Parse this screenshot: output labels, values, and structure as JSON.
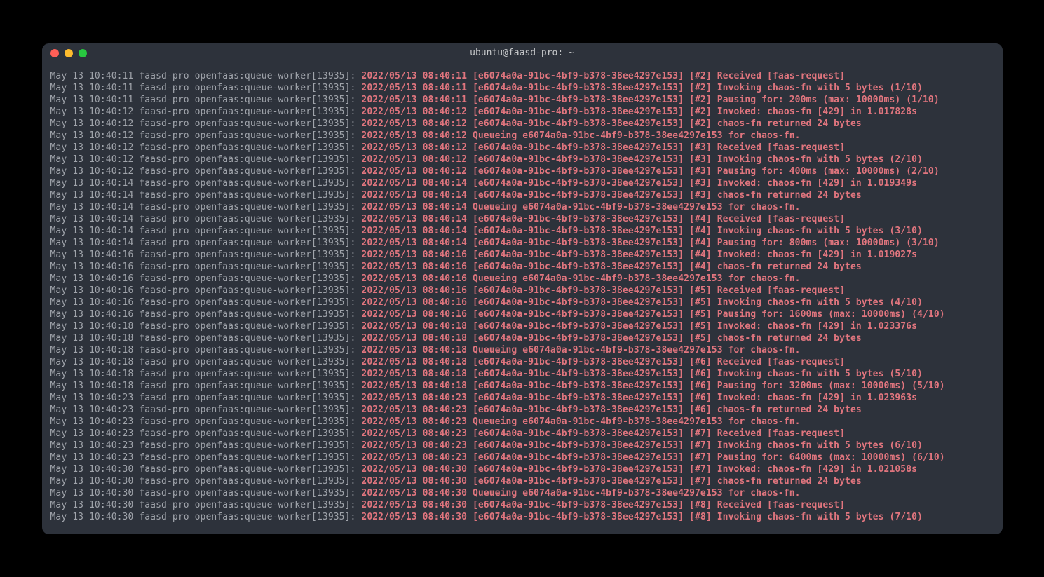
{
  "window": {
    "title": "ubuntu@faasd-pro: ~"
  },
  "colors": {
    "prefix": "#a0a4ab",
    "message": "#e0757e",
    "background": "#2d323b"
  },
  "logs": [
    {
      "prefix": "May 13 10:40:11 faasd-pro openfaas:queue-worker[13935]: ",
      "msg": "2022/05/13 08:40:11 [e6074a0a-91bc-4bf9-b378-38ee4297e153] [#2] Received [faas-request]"
    },
    {
      "prefix": "May 13 10:40:11 faasd-pro openfaas:queue-worker[13935]: ",
      "msg": "2022/05/13 08:40:11 [e6074a0a-91bc-4bf9-b378-38ee4297e153] [#2] Invoking chaos-fn with 5 bytes (1/10)"
    },
    {
      "prefix": "May 13 10:40:11 faasd-pro openfaas:queue-worker[13935]: ",
      "msg": "2022/05/13 08:40:11 [e6074a0a-91bc-4bf9-b378-38ee4297e153] [#2] Pausing for: 200ms (max: 10000ms) (1/10)"
    },
    {
      "prefix": "May 13 10:40:12 faasd-pro openfaas:queue-worker[13935]: ",
      "msg": "2022/05/13 08:40:12 [e6074a0a-91bc-4bf9-b378-38ee4297e153] [#2] Invoked: chaos-fn [429] in 1.017828s"
    },
    {
      "prefix": "May 13 10:40:12 faasd-pro openfaas:queue-worker[13935]: ",
      "msg": "2022/05/13 08:40:12 [e6074a0a-91bc-4bf9-b378-38ee4297e153] [#2] chaos-fn returned 24 bytes"
    },
    {
      "prefix": "May 13 10:40:12 faasd-pro openfaas:queue-worker[13935]: ",
      "msg": "2022/05/13 08:40:12 Queueing e6074a0a-91bc-4bf9-b378-38ee4297e153 for chaos-fn."
    },
    {
      "prefix": "May 13 10:40:12 faasd-pro openfaas:queue-worker[13935]: ",
      "msg": "2022/05/13 08:40:12 [e6074a0a-91bc-4bf9-b378-38ee4297e153] [#3] Received [faas-request]"
    },
    {
      "prefix": "May 13 10:40:12 faasd-pro openfaas:queue-worker[13935]: ",
      "msg": "2022/05/13 08:40:12 [e6074a0a-91bc-4bf9-b378-38ee4297e153] [#3] Invoking chaos-fn with 5 bytes (2/10)"
    },
    {
      "prefix": "May 13 10:40:12 faasd-pro openfaas:queue-worker[13935]: ",
      "msg": "2022/05/13 08:40:12 [e6074a0a-91bc-4bf9-b378-38ee4297e153] [#3] Pausing for: 400ms (max: 10000ms) (2/10)"
    },
    {
      "prefix": "May 13 10:40:14 faasd-pro openfaas:queue-worker[13935]: ",
      "msg": "2022/05/13 08:40:14 [e6074a0a-91bc-4bf9-b378-38ee4297e153] [#3] Invoked: chaos-fn [429] in 1.019349s"
    },
    {
      "prefix": "May 13 10:40:14 faasd-pro openfaas:queue-worker[13935]: ",
      "msg": "2022/05/13 08:40:14 [e6074a0a-91bc-4bf9-b378-38ee4297e153] [#3] chaos-fn returned 24 bytes"
    },
    {
      "prefix": "May 13 10:40:14 faasd-pro openfaas:queue-worker[13935]: ",
      "msg": "2022/05/13 08:40:14 Queueing e6074a0a-91bc-4bf9-b378-38ee4297e153 for chaos-fn."
    },
    {
      "prefix": "May 13 10:40:14 faasd-pro openfaas:queue-worker[13935]: ",
      "msg": "2022/05/13 08:40:14 [e6074a0a-91bc-4bf9-b378-38ee4297e153] [#4] Received [faas-request]"
    },
    {
      "prefix": "May 13 10:40:14 faasd-pro openfaas:queue-worker[13935]: ",
      "msg": "2022/05/13 08:40:14 [e6074a0a-91bc-4bf9-b378-38ee4297e153] [#4] Invoking chaos-fn with 5 bytes (3/10)"
    },
    {
      "prefix": "May 13 10:40:14 faasd-pro openfaas:queue-worker[13935]: ",
      "msg": "2022/05/13 08:40:14 [e6074a0a-91bc-4bf9-b378-38ee4297e153] [#4] Pausing for: 800ms (max: 10000ms) (3/10)"
    },
    {
      "prefix": "May 13 10:40:16 faasd-pro openfaas:queue-worker[13935]: ",
      "msg": "2022/05/13 08:40:16 [e6074a0a-91bc-4bf9-b378-38ee4297e153] [#4] Invoked: chaos-fn [429] in 1.019027s"
    },
    {
      "prefix": "May 13 10:40:16 faasd-pro openfaas:queue-worker[13935]: ",
      "msg": "2022/05/13 08:40:16 [e6074a0a-91bc-4bf9-b378-38ee4297e153] [#4] chaos-fn returned 24 bytes"
    },
    {
      "prefix": "May 13 10:40:16 faasd-pro openfaas:queue-worker[13935]: ",
      "msg": "2022/05/13 08:40:16 Queueing e6074a0a-91bc-4bf9-b378-38ee4297e153 for chaos-fn."
    },
    {
      "prefix": "May 13 10:40:16 faasd-pro openfaas:queue-worker[13935]: ",
      "msg": "2022/05/13 08:40:16 [e6074a0a-91bc-4bf9-b378-38ee4297e153] [#5] Received [faas-request]"
    },
    {
      "prefix": "May 13 10:40:16 faasd-pro openfaas:queue-worker[13935]: ",
      "msg": "2022/05/13 08:40:16 [e6074a0a-91bc-4bf9-b378-38ee4297e153] [#5] Invoking chaos-fn with 5 bytes (4/10)"
    },
    {
      "prefix": "May 13 10:40:16 faasd-pro openfaas:queue-worker[13935]: ",
      "msg": "2022/05/13 08:40:16 [e6074a0a-91bc-4bf9-b378-38ee4297e153] [#5] Pausing for: 1600ms (max: 10000ms) (4/10)"
    },
    {
      "prefix": "May 13 10:40:18 faasd-pro openfaas:queue-worker[13935]: ",
      "msg": "2022/05/13 08:40:18 [e6074a0a-91bc-4bf9-b378-38ee4297e153] [#5] Invoked: chaos-fn [429] in 1.023376s"
    },
    {
      "prefix": "May 13 10:40:18 faasd-pro openfaas:queue-worker[13935]: ",
      "msg": "2022/05/13 08:40:18 [e6074a0a-91bc-4bf9-b378-38ee4297e153] [#5] chaos-fn returned 24 bytes"
    },
    {
      "prefix": "May 13 10:40:18 faasd-pro openfaas:queue-worker[13935]: ",
      "msg": "2022/05/13 08:40:18 Queueing e6074a0a-91bc-4bf9-b378-38ee4297e153 for chaos-fn."
    },
    {
      "prefix": "May 13 10:40:18 faasd-pro openfaas:queue-worker[13935]: ",
      "msg": "2022/05/13 08:40:18 [e6074a0a-91bc-4bf9-b378-38ee4297e153] [#6] Received [faas-request]"
    },
    {
      "prefix": "May 13 10:40:18 faasd-pro openfaas:queue-worker[13935]: ",
      "msg": "2022/05/13 08:40:18 [e6074a0a-91bc-4bf9-b378-38ee4297e153] [#6] Invoking chaos-fn with 5 bytes (5/10)"
    },
    {
      "prefix": "May 13 10:40:18 faasd-pro openfaas:queue-worker[13935]: ",
      "msg": "2022/05/13 08:40:18 [e6074a0a-91bc-4bf9-b378-38ee4297e153] [#6] Pausing for: 3200ms (max: 10000ms) (5/10)"
    },
    {
      "prefix": "May 13 10:40:23 faasd-pro openfaas:queue-worker[13935]: ",
      "msg": "2022/05/13 08:40:23 [e6074a0a-91bc-4bf9-b378-38ee4297e153] [#6] Invoked: chaos-fn [429] in 1.023963s"
    },
    {
      "prefix": "May 13 10:40:23 faasd-pro openfaas:queue-worker[13935]: ",
      "msg": "2022/05/13 08:40:23 [e6074a0a-91bc-4bf9-b378-38ee4297e153] [#6] chaos-fn returned 24 bytes"
    },
    {
      "prefix": "May 13 10:40:23 faasd-pro openfaas:queue-worker[13935]: ",
      "msg": "2022/05/13 08:40:23 Queueing e6074a0a-91bc-4bf9-b378-38ee4297e153 for chaos-fn."
    },
    {
      "prefix": "May 13 10:40:23 faasd-pro openfaas:queue-worker[13935]: ",
      "msg": "2022/05/13 08:40:23 [e6074a0a-91bc-4bf9-b378-38ee4297e153] [#7] Received [faas-request]"
    },
    {
      "prefix": "May 13 10:40:23 faasd-pro openfaas:queue-worker[13935]: ",
      "msg": "2022/05/13 08:40:23 [e6074a0a-91bc-4bf9-b378-38ee4297e153] [#7] Invoking chaos-fn with 5 bytes (6/10)"
    },
    {
      "prefix": "May 13 10:40:23 faasd-pro openfaas:queue-worker[13935]: ",
      "msg": "2022/05/13 08:40:23 [e6074a0a-91bc-4bf9-b378-38ee4297e153] [#7] Pausing for: 6400ms (max: 10000ms) (6/10)"
    },
    {
      "prefix": "May 13 10:40:30 faasd-pro openfaas:queue-worker[13935]: ",
      "msg": "2022/05/13 08:40:30 [e6074a0a-91bc-4bf9-b378-38ee4297e153] [#7] Invoked: chaos-fn [429] in 1.021058s"
    },
    {
      "prefix": "May 13 10:40:30 faasd-pro openfaas:queue-worker[13935]: ",
      "msg": "2022/05/13 08:40:30 [e6074a0a-91bc-4bf9-b378-38ee4297e153] [#7] chaos-fn returned 24 bytes"
    },
    {
      "prefix": "May 13 10:40:30 faasd-pro openfaas:queue-worker[13935]: ",
      "msg": "2022/05/13 08:40:30 Queueing e6074a0a-91bc-4bf9-b378-38ee4297e153 for chaos-fn."
    },
    {
      "prefix": "May 13 10:40:30 faasd-pro openfaas:queue-worker[13935]: ",
      "msg": "2022/05/13 08:40:30 [e6074a0a-91bc-4bf9-b378-38ee4297e153] [#8] Received [faas-request]"
    },
    {
      "prefix": "May 13 10:40:30 faasd-pro openfaas:queue-worker[13935]: ",
      "msg": "2022/05/13 08:40:30 [e6074a0a-91bc-4bf9-b378-38ee4297e153] [#8] Invoking chaos-fn with 5 bytes (7/10)"
    }
  ]
}
